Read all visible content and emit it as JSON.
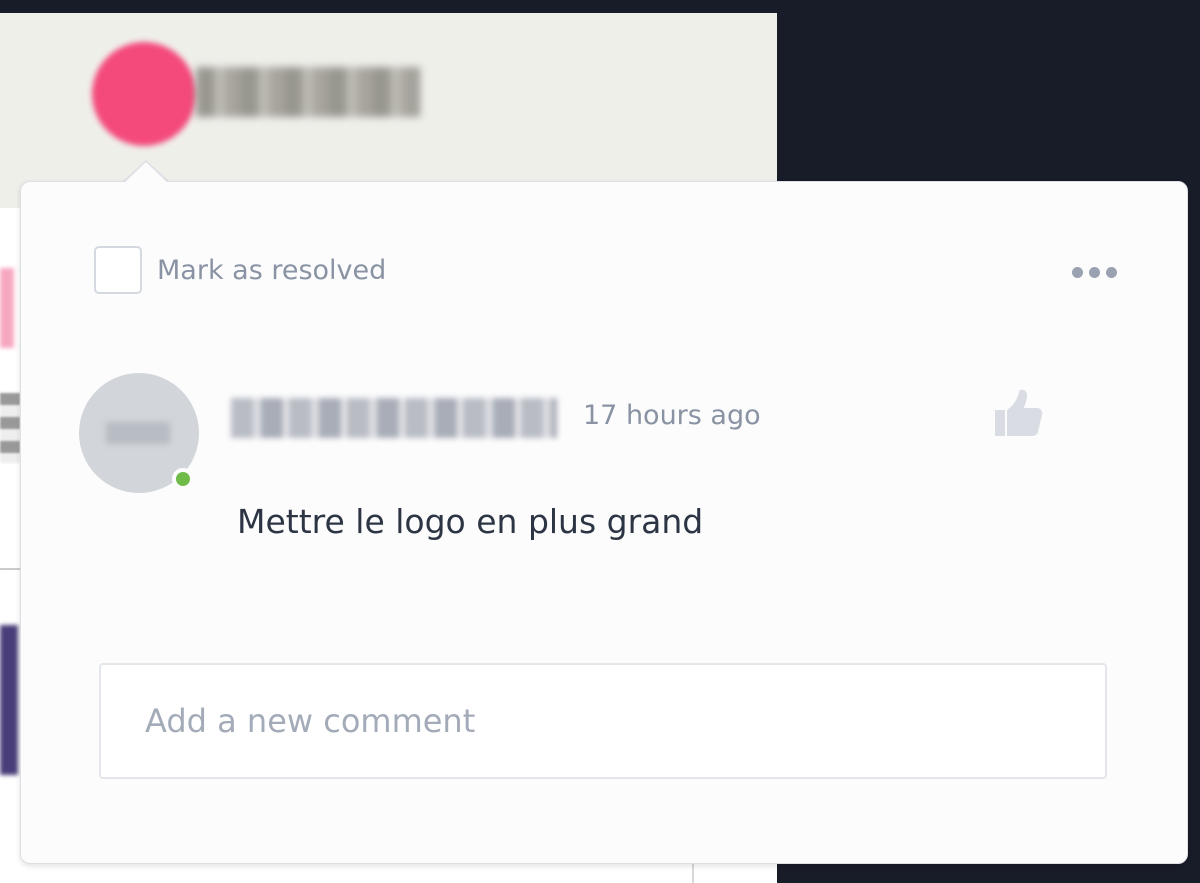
{
  "background": {
    "header_color": "#efefea",
    "pin_color": "#f34a7a",
    "dark_color": "#181c28"
  },
  "popover": {
    "resolve": {
      "label": "Mark as resolved",
      "checked": false
    },
    "menu_icon": "more-horizontal-icon",
    "comment": {
      "avatar_status": "online",
      "timestamp": "17 hours ago",
      "text": "Mettre le logo en plus grand",
      "like_icon": "thumbs-up-icon"
    },
    "new_comment": {
      "placeholder": "Add a new comment",
      "value": ""
    }
  }
}
